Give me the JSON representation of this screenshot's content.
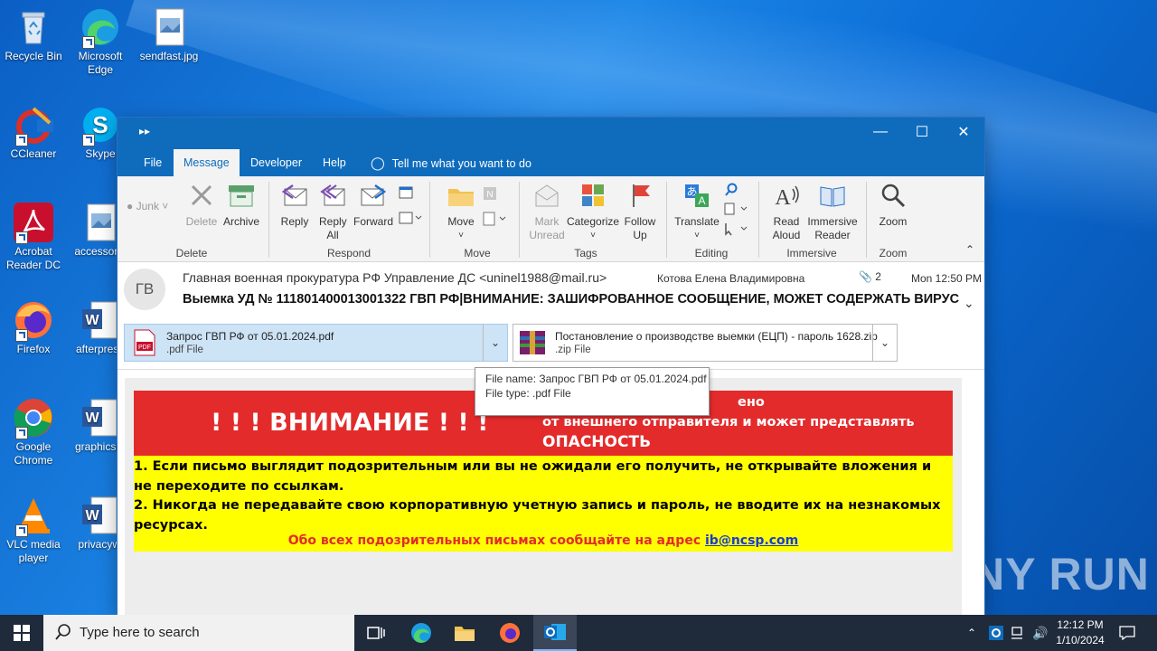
{
  "desktop": {
    "icons": [
      {
        "label": "Recycle Bin"
      },
      {
        "label": "Microsoft Edge"
      },
      {
        "label": "sendfast.jpg"
      },
      {
        "label": "CCleaner"
      },
      {
        "label": "Skype"
      },
      {
        "label": "Acrobat Reader DC"
      },
      {
        "label": "accessorie"
      },
      {
        "label": "Firefox"
      },
      {
        "label": "afterprese"
      },
      {
        "label": "Google Chrome"
      },
      {
        "label": "graphicsre"
      },
      {
        "label": "VLC media player"
      },
      {
        "label": "privacywi"
      }
    ],
    "watermark": "ANY RUN"
  },
  "window": {
    "tabs": [
      {
        "label": "File"
      },
      {
        "label": "Message"
      },
      {
        "label": "Developer"
      },
      {
        "label": "Help"
      }
    ],
    "tell_me": "Tell me what you want to do",
    "ribbon": {
      "junk": "Junk",
      "delete": "Delete",
      "archive": "Archive",
      "reply": "Reply",
      "reply_all": "Reply All",
      "forward": "Forward",
      "move": "Move",
      "mark_unread": "Mark Unread",
      "categorize": "Categorize",
      "follow_up": "Follow Up",
      "translate": "Translate",
      "read_aloud": "Read Aloud",
      "immersive_reader": "Immersive Reader",
      "zoom": "Zoom",
      "groups": {
        "delete": "Delete",
        "respond": "Respond",
        "move": "Move",
        "tags": "Tags",
        "editing": "Editing",
        "immersive": "Immersive",
        "zoom": "Zoom"
      }
    }
  },
  "message": {
    "avatar_initials": "ГВ",
    "from": "Главная военная прокуратура РФ Управление ДС <uninel1988@mail.ru>",
    "to": "Котова Елена Владимировна",
    "attachment_count": "2",
    "date": "Mon 12:50 PM",
    "subject": "Выемка УД № 111801400013001322  ГВП РФ|ВНИМАНИЕ: ЗАШИФРОВАННОЕ СООБЩЕНИЕ, МОЖЕТ СОДЕРЖАТЬ ВИРУСЫ!",
    "attachments": [
      {
        "name": "Запрос ГВП РФ от 05.01.2024.pdf",
        "type": ".pdf File"
      },
      {
        "name": "Постановление о производстве выемки (ЕЦП) - пароль 1628.zip",
        "type": ".zip File"
      }
    ],
    "tooltip": {
      "line1": "File name:  Запрос ГВП РФ от 05.01.2024.pdf",
      "line2": "File type:  .pdf File"
    },
    "body": {
      "warning_title": "! ! ! ВНИМАНИЕ ! ! !",
      "red_line1": "ено",
      "red_line2": "от внешнего отправителя и может представлять",
      "red_line3": "ОПАСНОСТЬ",
      "item1": "1. Если письмо выглядит подозрительным или вы не ожидали его получить, не открывайте вложения и не переходите по ссылкам.",
      "item2": "2. Никогда не передавайте свою корпоративную учетную запись и пароль, не вводите их на незнакомых ресурсах.",
      "report_text": "Обо всех подозрительных письмах сообщайте на адрес ",
      "report_email": "ib@ncsp.com"
    }
  },
  "taskbar": {
    "search_placeholder": "Type here to search",
    "time": "12:12 PM",
    "date": "1/10/2024"
  },
  "colors": {
    "outlook_blue": "#0f6cbd",
    "warning_red": "#e32b2b",
    "warning_yellow": "#ffff00"
  }
}
